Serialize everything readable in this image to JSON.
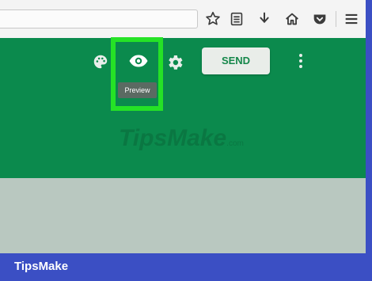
{
  "browser": {
    "icons": [
      "star-icon",
      "reader-list-icon",
      "download-icon",
      "home-icon",
      "pocket-icon",
      "hamburger-menu-icon"
    ]
  },
  "toolbar": {
    "icons": [
      "palette-icon",
      "eye-icon",
      "gear-icon",
      "more-vert-icon"
    ],
    "preview_tooltip": "Preview",
    "send_label": "SEND"
  },
  "watermark": {
    "text": "TipsMake",
    "suffix": ".com"
  },
  "footer": {
    "brand": "TipsMake"
  },
  "colors": {
    "app_bar": "#0b8a4d",
    "highlight": "#25e226",
    "outer_border": "#3b4fc4",
    "body": "#b9c8c0"
  }
}
